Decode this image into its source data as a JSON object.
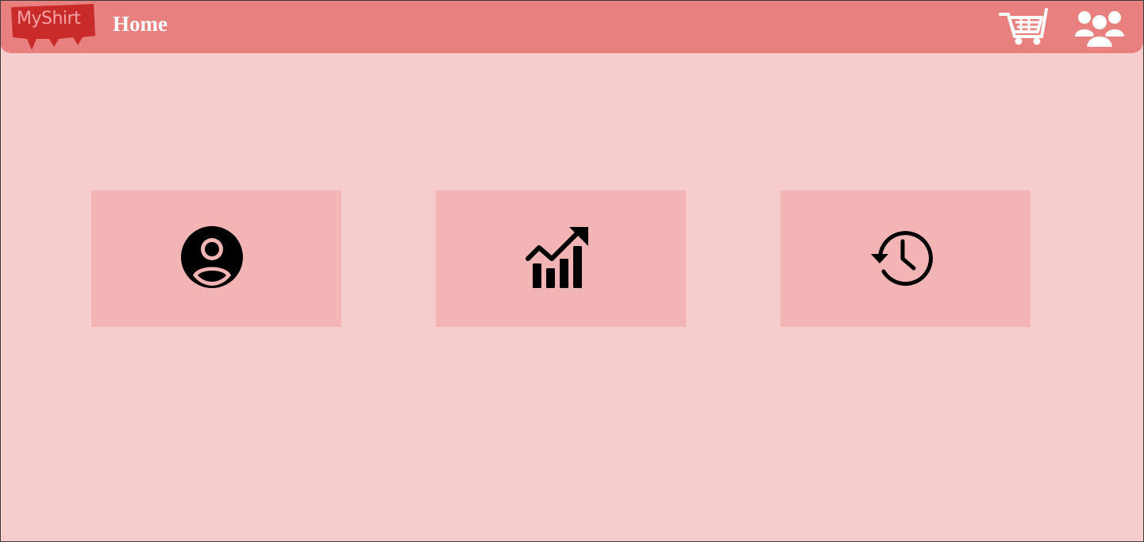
{
  "app": {
    "logo_text": "MyShirt",
    "page_title": "Home"
  },
  "header": {
    "actions": [
      {
        "icon": "shopping-cart-icon"
      },
      {
        "icon": "users-group-icon"
      }
    ]
  },
  "main": {
    "tiles": [
      {
        "icon": "user-account-icon"
      },
      {
        "icon": "growth-chart-icon"
      },
      {
        "icon": "history-clock-icon"
      }
    ]
  },
  "colors": {
    "page_background": "#f6cccc",
    "header_background": "#e98080",
    "tile_background": "#f2b4b4",
    "logo_red": "#c92b2b",
    "icon_white": "#ffffff",
    "icon_black": "#000000"
  }
}
